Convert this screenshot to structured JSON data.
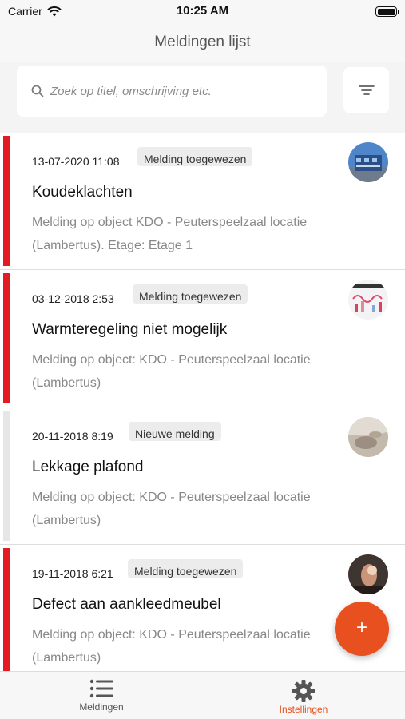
{
  "status": {
    "carrier": "Carrier",
    "time": "10:25 AM"
  },
  "nav": {
    "title": "Meldingen lijst"
  },
  "search": {
    "placeholder": "Zoek op titel, omschrijving etc."
  },
  "reports": [
    {
      "date": "13-07-2020 11:08",
      "badge": "Melding toegewezen",
      "title": "Koudeklachten",
      "desc": "Melding op object KDO - Peuterspeelzaal locatie (Lambertus). Etage: Etage 1",
      "stripe": "#e31b23"
    },
    {
      "date": "03-12-2018 2:53",
      "badge": "Melding toegewezen",
      "title": "Warmteregeling niet mogelijk",
      "desc": "Melding op object: KDO - Peuterspeelzaal locatie (Lambertus)",
      "stripe": "#e31b23"
    },
    {
      "date": "20-11-2018 8:19",
      "badge": "Nieuwe melding",
      "title": "Lekkage plafond",
      "desc": "Melding op object: KDO - Peuterspeelzaal locatie (Lambertus)",
      "stripe": "#e6e6e6"
    },
    {
      "date": "19-11-2018 6:21",
      "badge": "Melding toegewezen",
      "title": "Defect aan aankleedmeubel",
      "desc": "Melding op object: KDO - Peuterspeelzaal locatie (Lambertus)",
      "stripe": "#e31b23"
    }
  ],
  "fab": {
    "label": "+"
  },
  "tabs": [
    {
      "label": "Meldingen",
      "icon": "list-icon"
    },
    {
      "label": "Instellingen",
      "icon": "gear-icon"
    }
  ],
  "colors": {
    "accent": "#e8501f",
    "stripe_assigned": "#e31b23",
    "stripe_new": "#e6e6e6",
    "tab_active": "#e8501f",
    "tab_inactive": "#555555"
  }
}
